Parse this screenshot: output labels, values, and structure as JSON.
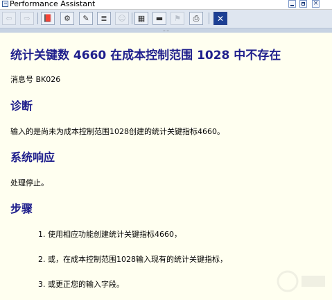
{
  "window": {
    "title": "Performance Assistant"
  },
  "toolbar": {
    "buttons": [
      {
        "icon": "back-arrow-icon",
        "glyph": "⇦",
        "enabled": false
      },
      {
        "icon": "forward-arrow-icon",
        "glyph": "⇨",
        "enabled": false
      },
      {
        "icon": "book-icon",
        "glyph": "📕",
        "enabled": true
      },
      {
        "icon": "technical-info-icon",
        "glyph": "⚙",
        "enabled": true
      },
      {
        "icon": "edit-icon",
        "glyph": "✎",
        "enabled": true
      },
      {
        "icon": "glossary-icon",
        "glyph": "≣",
        "enabled": true
      },
      {
        "icon": "person-icon",
        "glyph": "☺",
        "enabled": false
      },
      {
        "icon": "table-icon",
        "glyph": "▦",
        "enabled": true
      },
      {
        "icon": "note-icon",
        "glyph": "▬",
        "enabled": true
      },
      {
        "icon": "bookmark-icon",
        "glyph": "⚑",
        "enabled": false
      },
      {
        "icon": "print-icon",
        "glyph": "⎙",
        "enabled": true
      },
      {
        "icon": "exit-icon",
        "glyph": "✕",
        "enabled": true
      }
    ],
    "splitter_grip": "....."
  },
  "content": {
    "title": "统计关键数 4660 在成本控制范围 1028 中不存在",
    "message_number": "消息号 BK026",
    "sections": [
      {
        "heading": "诊断",
        "text": "输入的是尚未为成本控制范围1028创建的统计关键指标4660。"
      },
      {
        "heading": "系统响应",
        "text": "处理停止。"
      },
      {
        "heading": "步骤",
        "text": ""
      }
    ],
    "steps": [
      "1. 使用相应功能创建统计关键指标4660，",
      "2. 或，在成本控制范围1028输入现有的统计关键指标，",
      "3. 或更正您的输入字段。"
    ]
  }
}
